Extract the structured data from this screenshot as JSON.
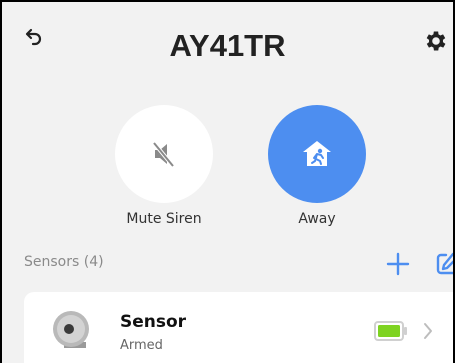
{
  "header": {
    "title": "AY41TR"
  },
  "actions": {
    "mute": {
      "label": "Mute Siren"
    },
    "away": {
      "label": "Away"
    }
  },
  "sensors": {
    "title": "Sensors",
    "count": "(4)",
    "items": [
      {
        "name": "Sensor",
        "status": "Armed"
      }
    ]
  },
  "colors": {
    "accent": "#4d8ef0",
    "battery": "#7ed321",
    "background": "#f2f2f2"
  },
  "icons": {
    "back": "back-arrow-icon",
    "settings": "gear-icon",
    "mute": "speaker-muted-icon",
    "away": "house-running-person-icon",
    "add": "plus-icon",
    "edit": "pencil-icon",
    "sensor": "camera-sensor-icon",
    "battery": "battery-icon",
    "chevron": "chevron-right-icon"
  }
}
